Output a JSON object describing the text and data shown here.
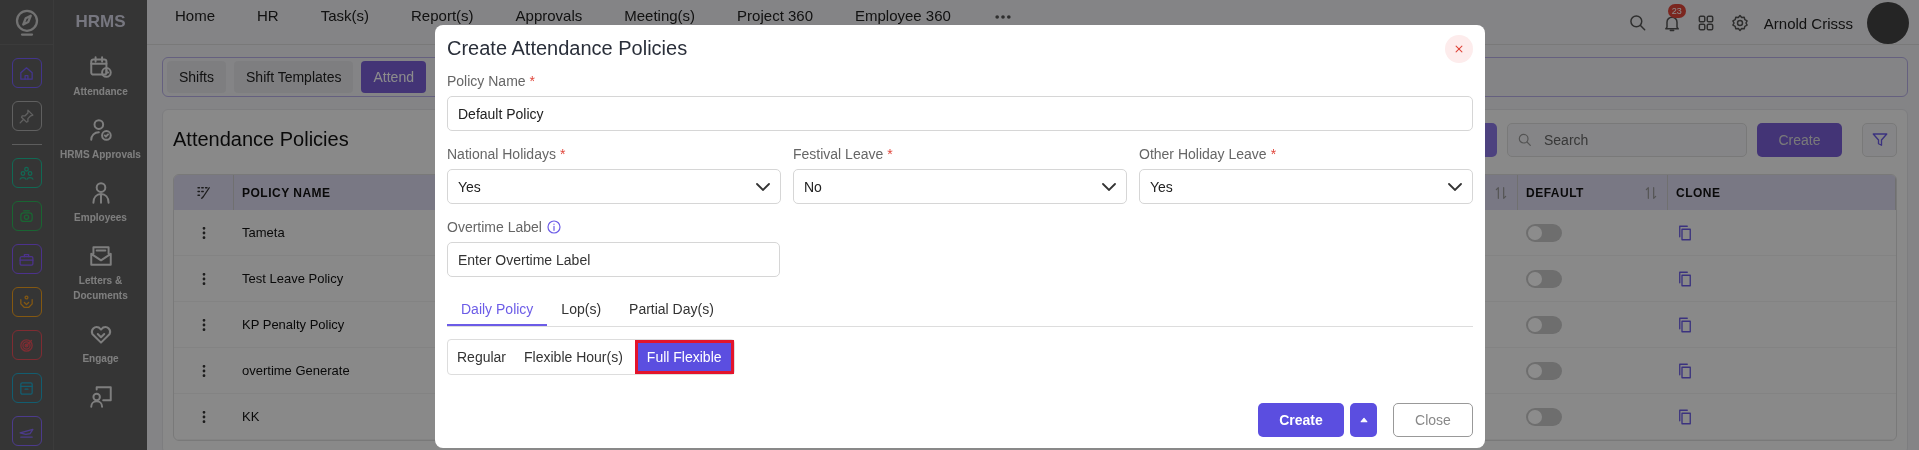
{
  "rail": {
    "pinned": [
      {
        "kind": "home"
      },
      {
        "kind": "pin"
      }
    ],
    "apps": [
      {
        "kind": "people"
      },
      {
        "kind": "cloud"
      },
      {
        "kind": "briefcase"
      },
      {
        "kind": "hands"
      },
      {
        "kind": "target"
      },
      {
        "kind": "box"
      },
      {
        "kind": "plane"
      }
    ]
  },
  "sidebar": {
    "title": "HRMS",
    "items": [
      {
        "kind": "calendar",
        "label": "Attendance"
      },
      {
        "kind": "person-check",
        "label": "HRMS Approvals"
      },
      {
        "kind": "person",
        "label": "Employees"
      },
      {
        "kind": "envelope",
        "label": "Letters & Documents"
      },
      {
        "kind": "handshake",
        "label": "Engage"
      },
      {
        "kind": "presenter"
      }
    ]
  },
  "nav": {
    "items": [
      "Home",
      "HR",
      "Task(s)",
      "Report(s)",
      "Approvals",
      "Meeting(s)",
      "Project 360",
      "Employee 360"
    ]
  },
  "header": {
    "notification_count": "23",
    "user_name": "Arnold Crisss"
  },
  "page_tabs": [
    {
      "label": "Shifts",
      "selected": false
    },
    {
      "label": "Shift Templates",
      "selected": false
    },
    {
      "label": "Attend",
      "selected": true
    }
  ],
  "page": {
    "title": "Attendance Policies",
    "search": {
      "placeholder": "Search"
    },
    "create_button": "Create"
  },
  "table": {
    "columns": [
      {
        "label": "POLICY NAME"
      },
      {
        "sortable": true
      },
      {
        "label": "DEFAULT",
        "sortable": true
      },
      {
        "label": "CLONE",
        "sortable": false
      }
    ],
    "rows": [
      {
        "name": "Tameta",
        "default": false
      },
      {
        "name": "Test Leave Policy",
        "default": false
      },
      {
        "name": "KP Penalty Policy",
        "default": false
      },
      {
        "name": "overtime Generate",
        "default": false
      },
      {
        "name": "KK",
        "default": false
      }
    ]
  },
  "modal": {
    "title": "Create Attendance Policies",
    "policy_name": {
      "label": "Policy Name",
      "required_mark": "*",
      "value": "Default Policy"
    },
    "holiday_fields": [
      {
        "label": "National Holidays",
        "required_mark": "*",
        "value": "Yes"
      },
      {
        "label": "Festival Leave",
        "required_mark": "*",
        "value": "No"
      },
      {
        "label": "Other Holiday Leave",
        "required_mark": "*",
        "value": "Yes"
      }
    ],
    "overtime_label": {
      "label": "Overtime Label",
      "info": true,
      "placeholder": "Enter Overtime Label"
    },
    "tabs": [
      {
        "label": "Daily Policy",
        "selected": true
      },
      {
        "label": "Lop(s)",
        "selected": false
      },
      {
        "label": "Partial Day(s)",
        "selected": false
      }
    ],
    "modes": [
      {
        "label": "Regular",
        "selected": false
      },
      {
        "label": "Flexible Hour(s)",
        "selected": false
      },
      {
        "label": "Full Flexible",
        "selected": true
      }
    ],
    "create_button": "Create",
    "close_button": "Close"
  }
}
